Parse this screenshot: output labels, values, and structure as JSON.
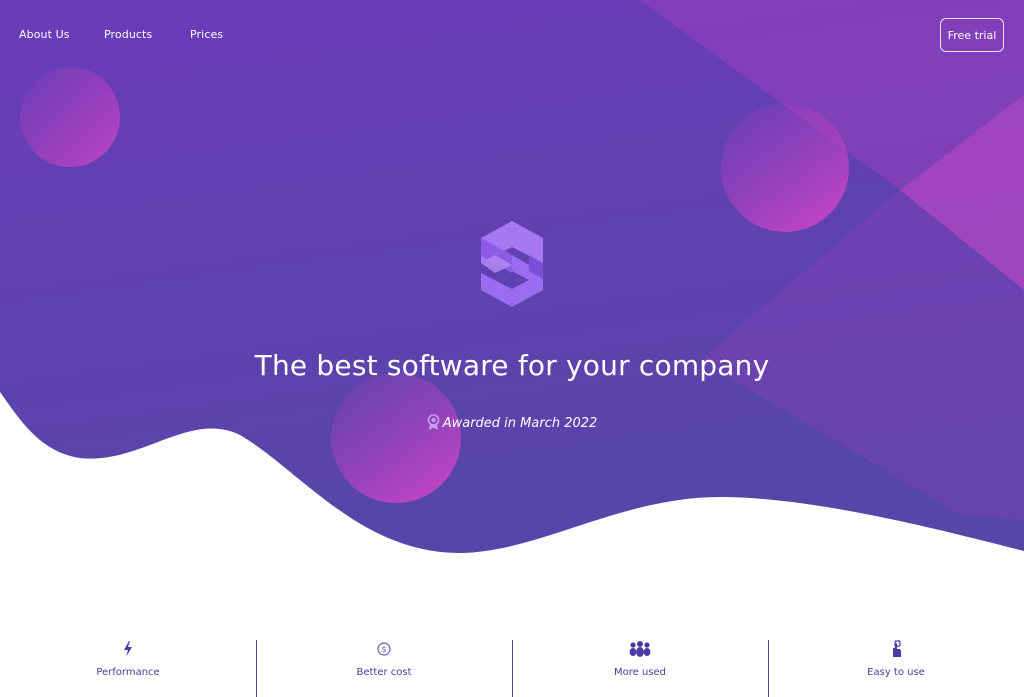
{
  "nav": {
    "links": [
      {
        "label": "About Us"
      },
      {
        "label": "Products"
      },
      {
        "label": "Prices"
      }
    ],
    "cta_label": "Free trial"
  },
  "hero": {
    "logo_icon": "brand-s-hexagon-icon",
    "headline": "The best software for your company",
    "award_icon": "award-ribbon-icon",
    "award_text": "Awarded in March 2022"
  },
  "features": [
    {
      "icon": "lightning-bolt-icon",
      "label": "Performance"
    },
    {
      "icon": "coin-icon",
      "label": "Better cost"
    },
    {
      "icon": "users-group-icon",
      "label": "More used"
    },
    {
      "icon": "touch-hand-icon",
      "label": "Easy to use"
    }
  ],
  "colors": {
    "hero_gradient_start": "#6a3ab8",
    "hero_gradient_end": "#5a44a6",
    "accent_pink": "#c146c8",
    "logo_purple": "#9b6cf0",
    "feature_text": "#4a3aa0"
  }
}
